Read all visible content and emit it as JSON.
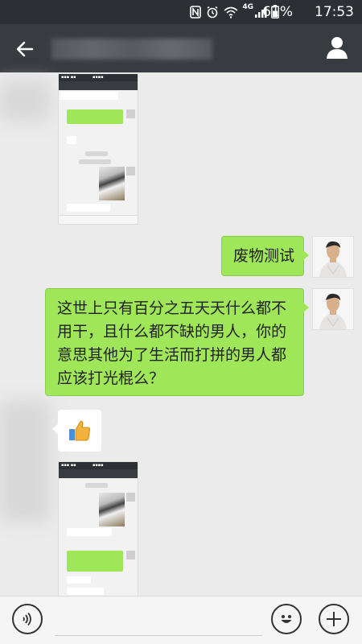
{
  "status_bar": {
    "network": "4G",
    "battery_percent": "61%",
    "time": "17:53"
  },
  "messages": [
    {
      "type": "sent",
      "text": "废物测试"
    },
    {
      "type": "sent",
      "text": "这世上只有百分之五天天什么都不用干，且什么都不缺的男人，你的意思其他为了生活而打拼的男人都应该打光棍么？"
    }
  ],
  "colors": {
    "status_bar": "#2c2f33",
    "nav_bar": "#383b3f",
    "chat_background": "#ebebeb",
    "sent_bubble": "#9fe658"
  },
  "icons": {
    "back": "arrow-left",
    "profile": "person",
    "voice": "voice-wave",
    "emoji": "smiley",
    "more": "plus"
  }
}
